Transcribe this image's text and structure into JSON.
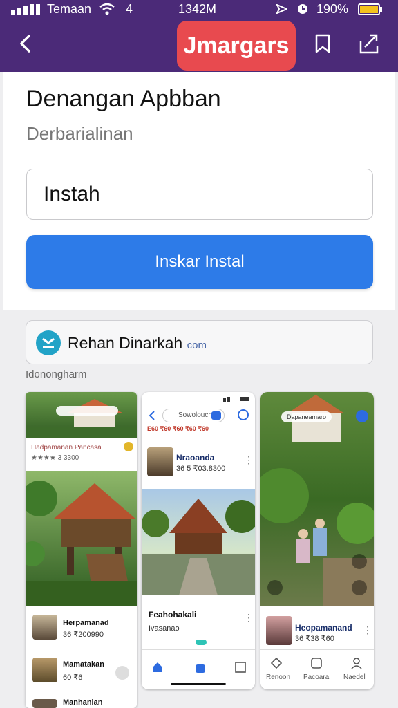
{
  "status": {
    "carrier": "Temaan",
    "network": "4",
    "time": "1342M",
    "battery": "190%"
  },
  "navbar": {
    "brand": "Jmargars"
  },
  "header": {
    "title": "Denangan Apbban",
    "subtitle": "Derbarialinan"
  },
  "search": {
    "value": "Instah"
  },
  "install_button": {
    "label": "Inskar Instal"
  },
  "developer": {
    "name": "Rehan Dinarkah",
    "suffix": "com"
  },
  "screenshots_label": "Idonongharm",
  "shot1": {
    "title": "Hadpamanan Pancasa",
    "subtitle": "★★★★ 3 3300",
    "items": [
      {
        "name": "Herpamanad",
        "price": "36 ₹200990"
      },
      {
        "name": "Mamatakan",
        "price": "60 ₹6"
      },
      {
        "name": "Manhanlan",
        "price": ""
      }
    ]
  },
  "shot2": {
    "search": "Sowolouch",
    "tags": "E60 ₹60 ₹60 ₹60 ₹60",
    "items": [
      {
        "name": "Nraoanda",
        "price": "36 5 ₹03.8300"
      },
      {
        "name": "Feahohakali",
        "price": "Ivasanao"
      }
    ]
  },
  "shot3": {
    "pill": "Dapaneamaro",
    "items": [
      {
        "name": "Heopamanand",
        "price": "36 ₹38 ₹60"
      }
    ],
    "tabs": [
      "Renoon",
      "Pacoara",
      "Naedel"
    ]
  }
}
